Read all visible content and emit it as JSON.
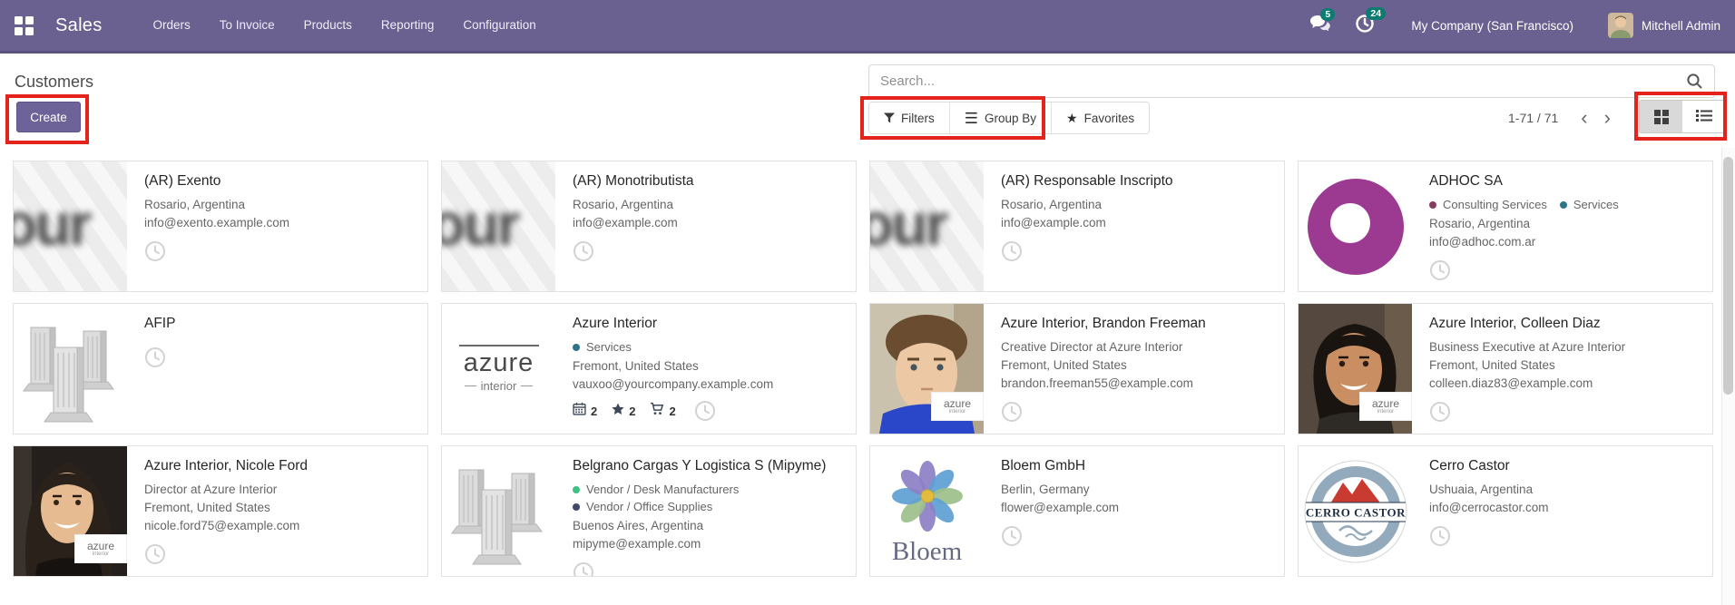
{
  "navbar": {
    "app_name": "Sales",
    "menu_items": [
      "Orders",
      "To Invoice",
      "Products",
      "Reporting",
      "Configuration"
    ],
    "messages_badge": "5",
    "activities_badge": "24",
    "company": "My Company (San Francisco)",
    "user": "Mitchell Admin"
  },
  "control_panel": {
    "breadcrumb": "Customers",
    "create_label": "Create",
    "search_placeholder": "Search...",
    "filters_label": "Filters",
    "group_by_label": "Group By",
    "favorites_label": "Favorites",
    "pager": "1-71 / 71",
    "prev_arrow": "‹",
    "next_arrow": "›"
  },
  "colors": {
    "navbar_bg": "#6b6191",
    "navbar_border": "#5b5280",
    "badge_teal": "#0c7b70",
    "primary_button": "#6d6398",
    "annotation_red": "#e3231c",
    "active_view_bg": "#d9d9d9"
  },
  "logos": {
    "blurred_word": "our",
    "azure_word": "azure",
    "interior_word": "interior",
    "bloem_word": "Bloem",
    "cerro_word": "CERRO CASTOR"
  },
  "cards": [
    {
      "name": "(AR) Exento",
      "location": "Rosario, Argentina",
      "email": "info@exento.example.com",
      "image": "blurred-logo"
    },
    {
      "name": "(AR) Monotributista",
      "location": "Rosario, Argentina",
      "email": "info@example.com",
      "image": "blurred-logo"
    },
    {
      "name": "(AR) Responsable Inscripto",
      "location": "Rosario, Argentina",
      "email": "info@example.com",
      "image": "blurred-logo"
    },
    {
      "name": "ADHOC SA",
      "tags": [
        {
          "label": "Consulting Services",
          "color": "#883c64"
        },
        {
          "label": "Services",
          "color": "#2e758c"
        }
      ],
      "location": "Rosario, Argentina",
      "email": "info@adhoc.com.ar",
      "image": "adhoc-logo"
    },
    {
      "name": "AFIP",
      "image": "buildings"
    },
    {
      "name": "Azure Interior",
      "tags": [
        {
          "label": "Services",
          "color": "#2e758c"
        }
      ],
      "location": "Fremont, United States",
      "email": "vauxoo@yourcompany.example.com",
      "image": "azure-logo",
      "counters": [
        {
          "icon": "calendar-icon",
          "value": "2"
        },
        {
          "icon": "star-icon",
          "value": "2"
        },
        {
          "icon": "cart-icon",
          "value": "2"
        }
      ]
    },
    {
      "name": "Azure Interior, Brandon Freeman",
      "subtitle": "Creative Director at Azure Interior",
      "location": "Fremont, United States",
      "email": "brandon.freeman55@example.com",
      "image": "photo-brandon",
      "badge_logo": true
    },
    {
      "name": "Azure Interior, Colleen Diaz",
      "subtitle": "Business Executive at Azure Interior",
      "location": "Fremont, United States",
      "email": "colleen.diaz83@example.com",
      "image": "photo-colleen",
      "badge_logo": true
    },
    {
      "name": "Azure Interior, Nicole Ford",
      "subtitle": "Director at Azure Interior",
      "location": "Fremont, United States",
      "email": "nicole.ford75@example.com",
      "image": "photo-nicole",
      "badge_logo": true
    },
    {
      "name": "Belgrano Cargas Y Logistica S (Mipyme)",
      "tags": [
        {
          "label": "Vendor / Desk Manufacturers",
          "color": "#3fc183"
        },
        {
          "label": "Vendor / Office Supplies",
          "color": "#3e4a6b"
        }
      ],
      "location": "Buenos Aires, Argentina",
      "email": "mipyme@example.com",
      "image": "buildings"
    },
    {
      "name": "Bloem GmbH",
      "location": "Berlin, Germany",
      "email": "flower@example.com",
      "image": "bloem-logo"
    },
    {
      "name": "Cerro Castor",
      "location": "Ushuaia, Argentina",
      "email": "info@cerrocastor.com",
      "image": "cerro-logo"
    }
  ]
}
